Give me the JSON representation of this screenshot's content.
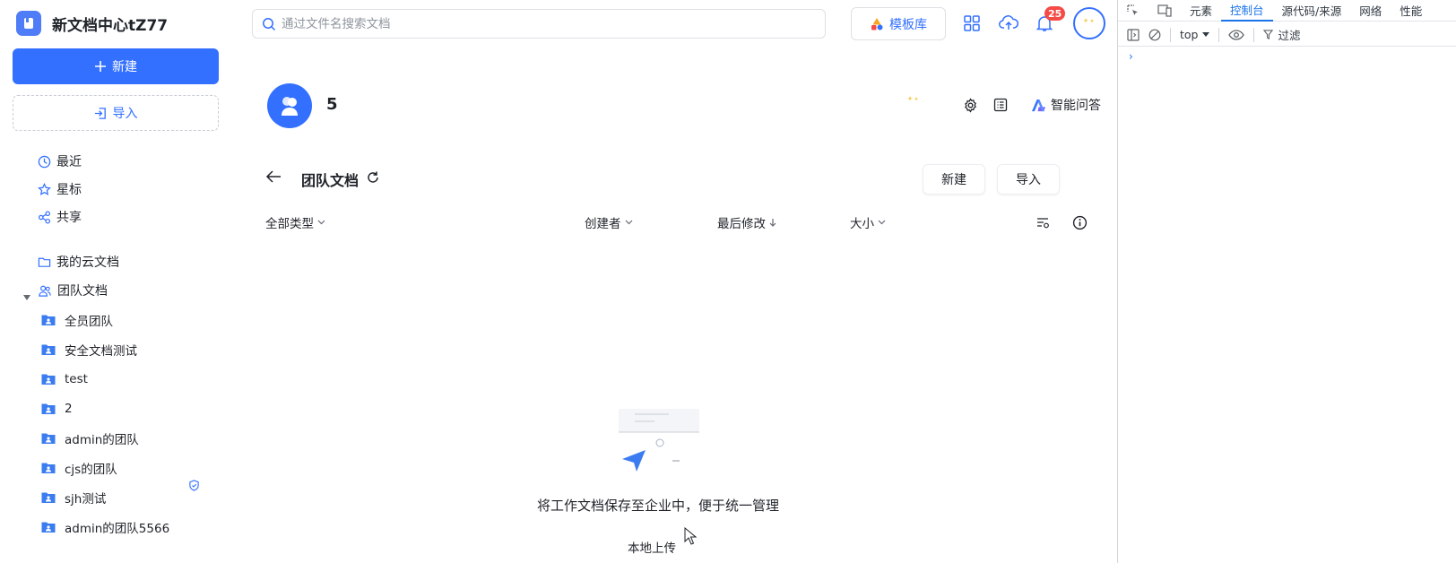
{
  "sidebar": {
    "brand_title": "新文档中心tZ77",
    "new_label": "新建",
    "import_label": "导入",
    "nav": [
      {
        "label": "最近",
        "icon": "clock-icon"
      },
      {
        "label": "星标",
        "icon": "star-icon"
      },
      {
        "label": "共享",
        "icon": "share-icon"
      },
      {
        "label": "我的云文档",
        "icon": "folder-icon"
      },
      {
        "label": "团队文档",
        "icon": "team-icon"
      }
    ],
    "teams": [
      "全员团队",
      "安全文档测试",
      "test",
      "2",
      "admin的团队",
      "cjs的团队",
      "sjh测试",
      "admin的团队5566"
    ]
  },
  "topbar": {
    "search_placeholder": "通过文件名搜索文档",
    "template_label": "模板库",
    "notification_count": "25"
  },
  "team_header": {
    "name": "5",
    "ai_label": "智能问答"
  },
  "section": {
    "title": "团队文档",
    "new_label": "新建",
    "import_label": "导入"
  },
  "columns": {
    "type": "全部类型",
    "creator": "创建者",
    "modified": "最后修改",
    "size": "大小"
  },
  "empty_state": {
    "message": "将工作文档保存至企业中，便于统一管理",
    "upload_label": "本地上传"
  },
  "devtools": {
    "tabs": [
      "元素",
      "控制台",
      "源代码/来源",
      "网络",
      "性能"
    ],
    "active_tab": "控制台",
    "context": "top",
    "filter_label": "过滤"
  },
  "colors": {
    "primary": "#3370ff",
    "text": "#1f2329",
    "badge": "#f54a45",
    "folder": "#3b7df0"
  }
}
